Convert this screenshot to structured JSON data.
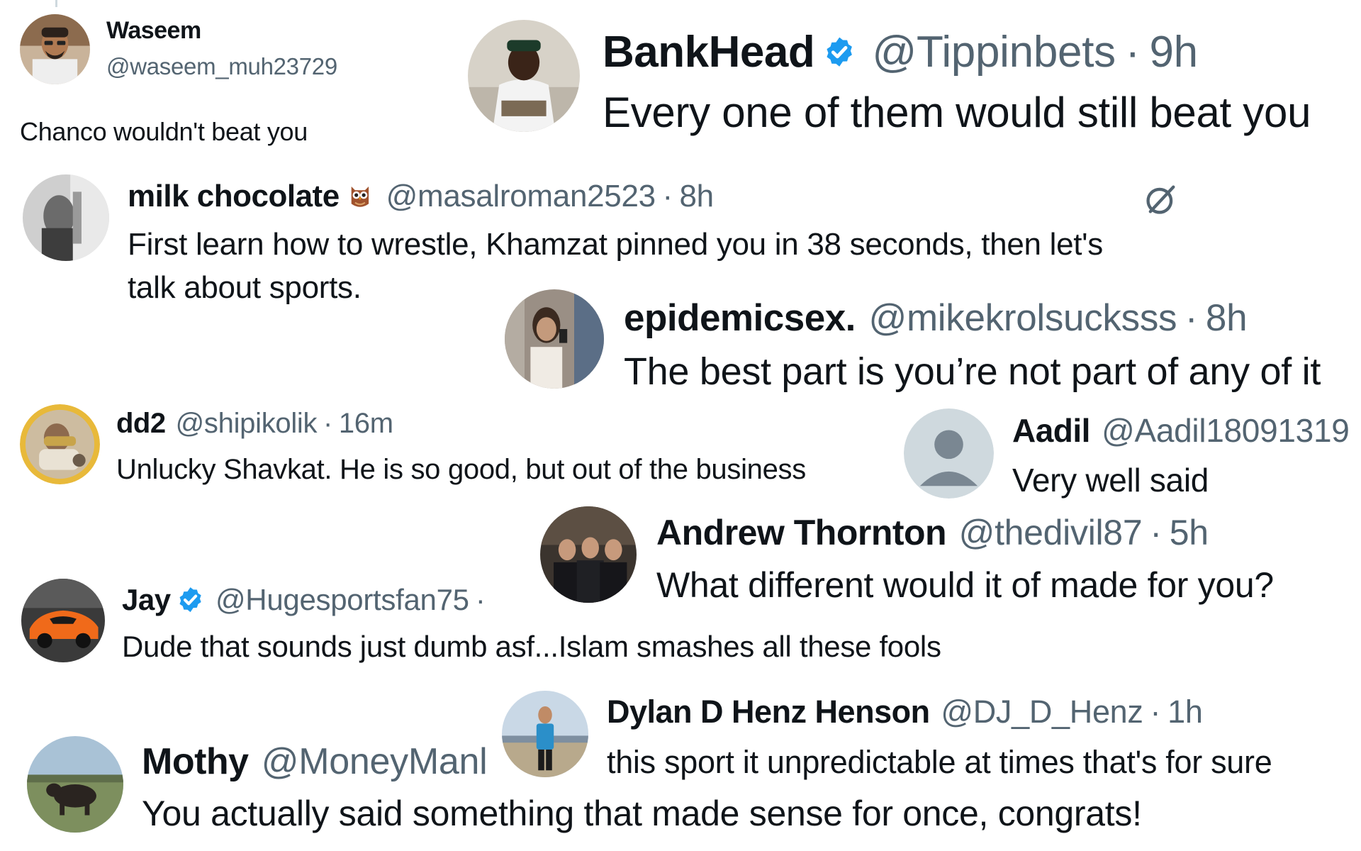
{
  "replies": [
    {
      "name": "Waseem",
      "handle": "@waseem_muh23729",
      "text": "Chanco wouldn't beat you"
    },
    {
      "name": "BankHead",
      "verified": true,
      "handle": "@Tippinbets",
      "time": "9h",
      "text": "Every one of them would still beat you"
    },
    {
      "name": "milk chocolate",
      "emoji": "owl-emoji",
      "handle": "@masalroman2523",
      "time": "8h",
      "text_lines": [
        "First learn how to wrestle, Khamzat pinned you in 38 seconds, then let's",
        "talk about sports."
      ]
    },
    {
      "name": "epidemicsex.",
      "handle": "@mikekrolsucksss",
      "time": "8h",
      "text": "The best part is you’re not part of any of it"
    },
    {
      "name": "dd2",
      "handle": "@shipikolik",
      "time": "16m",
      "text": "Unlucky Shavkat. He is so good, but out of the business"
    },
    {
      "name": "Aadil",
      "handle": "@Aadil18091319",
      "text": "Very well said"
    },
    {
      "name": "Andrew Thornton",
      "handle": "@thedivil87",
      "time": "5h",
      "text": "What different would it of made for you?"
    },
    {
      "name": "Jay",
      "verified": true,
      "handle": "@Hugesportsfan75",
      "text": "Dude that sounds just dumb asf...Islam smashes all these fools"
    },
    {
      "name": "Dylan D Henz Henson",
      "handle": "@DJ_D_Henz",
      "time": "1h",
      "text": "this sport it unpredictable at times that's for sure"
    },
    {
      "name": "Mothy",
      "handle": "@MoneyManl",
      "text": "You actually said something that made sense for once, congrats!"
    }
  ],
  "icons": {
    "verified": "verified-badge-icon",
    "grok": "grok-icon",
    "owl": "owl-emoji",
    "default_avatar": "default-avatar-icon"
  },
  "colors": {
    "text": "#0f1419",
    "secondary": "#536471",
    "verified_blue": "#1d9bf0",
    "background": "#ffffff"
  }
}
